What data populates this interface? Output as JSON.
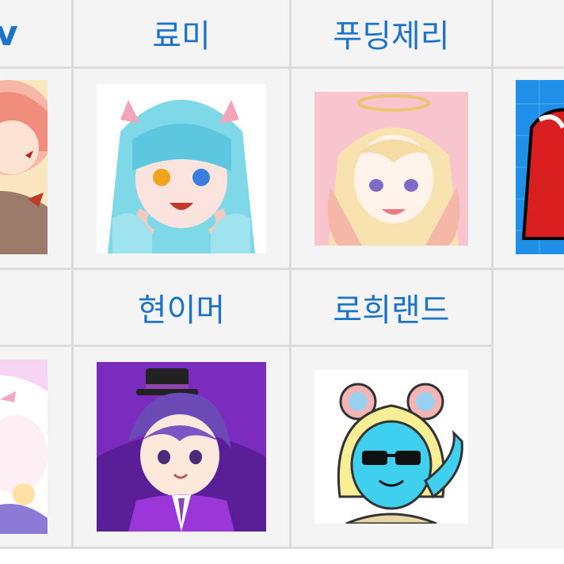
{
  "header_row_1": {
    "col_0_partial": "v",
    "col_1": "료미",
    "col_2": "푸딩제리",
    "col_3_partial": "",
    "header_color": "#1b74c9"
  },
  "header_row_2": {
    "col_0_partial": "",
    "col_1": "현이머",
    "col_2": "로희랜드"
  },
  "avatars_row_1": [
    {
      "icon": "red-hair-character-avatar-icon"
    },
    {
      "icon": "blue-hair-catgirl-avatar-icon"
    },
    {
      "icon": "blonde-halo-girl-avatar-icon"
    },
    {
      "icon": "red-spider-character-avatar-icon"
    }
  ],
  "avatars_row_2": [
    {
      "icon": "white-hair-girl-avatar-icon"
    },
    {
      "icon": "purple-hair-tophat-boy-avatar-icon"
    },
    {
      "icon": "cyan-bear-hood-sunglasses-avatar-icon"
    }
  ]
}
